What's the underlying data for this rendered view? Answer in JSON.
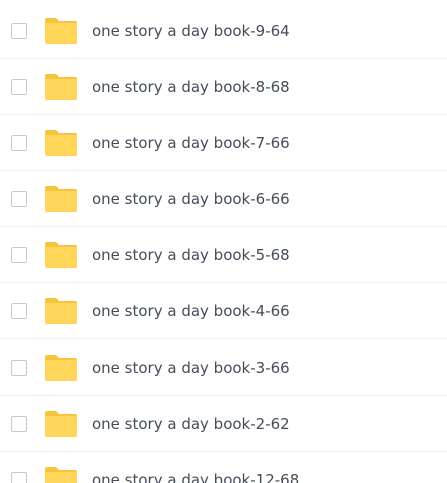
{
  "colors": {
    "folder": "#ffd659",
    "folder_back": "#f5c53d",
    "text": "#454d5a",
    "divider": "#f0f0f0",
    "checkbox_border": "#c9c9c9"
  },
  "icons": {
    "folder": "folder-icon"
  },
  "files": [
    {
      "name": "one story a day book-9-64"
    },
    {
      "name": "one story a day book-8-68"
    },
    {
      "name": "one story a day book-7-66"
    },
    {
      "name": "one story a day book-6-66"
    },
    {
      "name": "one story a day book-5-68"
    },
    {
      "name": "one story a day book-4-66"
    },
    {
      "name": "one story a day book-3-66"
    },
    {
      "name": "one story a day book-2-62"
    },
    {
      "name": "one story a day book-12-68"
    }
  ]
}
